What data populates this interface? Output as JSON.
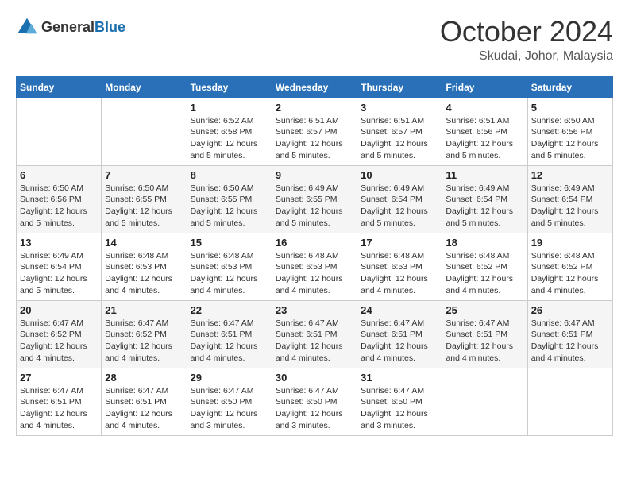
{
  "logo": {
    "general": "General",
    "blue": "Blue"
  },
  "header": {
    "month": "October 2024",
    "location": "Skudai, Johor, Malaysia"
  },
  "days_of_week": [
    "Sunday",
    "Monday",
    "Tuesday",
    "Wednesday",
    "Thursday",
    "Friday",
    "Saturday"
  ],
  "weeks": [
    [
      {
        "day": "",
        "detail": ""
      },
      {
        "day": "",
        "detail": ""
      },
      {
        "day": "1",
        "detail": "Sunrise: 6:52 AM\nSunset: 6:58 PM\nDaylight: 12 hours and 5 minutes."
      },
      {
        "day": "2",
        "detail": "Sunrise: 6:51 AM\nSunset: 6:57 PM\nDaylight: 12 hours and 5 minutes."
      },
      {
        "day": "3",
        "detail": "Sunrise: 6:51 AM\nSunset: 6:57 PM\nDaylight: 12 hours and 5 minutes."
      },
      {
        "day": "4",
        "detail": "Sunrise: 6:51 AM\nSunset: 6:56 PM\nDaylight: 12 hours and 5 minutes."
      },
      {
        "day": "5",
        "detail": "Sunrise: 6:50 AM\nSunset: 6:56 PM\nDaylight: 12 hours and 5 minutes."
      }
    ],
    [
      {
        "day": "6",
        "detail": "Sunrise: 6:50 AM\nSunset: 6:56 PM\nDaylight: 12 hours and 5 minutes."
      },
      {
        "day": "7",
        "detail": "Sunrise: 6:50 AM\nSunset: 6:55 PM\nDaylight: 12 hours and 5 minutes."
      },
      {
        "day": "8",
        "detail": "Sunrise: 6:50 AM\nSunset: 6:55 PM\nDaylight: 12 hours and 5 minutes."
      },
      {
        "day": "9",
        "detail": "Sunrise: 6:49 AM\nSunset: 6:55 PM\nDaylight: 12 hours and 5 minutes."
      },
      {
        "day": "10",
        "detail": "Sunrise: 6:49 AM\nSunset: 6:54 PM\nDaylight: 12 hours and 5 minutes."
      },
      {
        "day": "11",
        "detail": "Sunrise: 6:49 AM\nSunset: 6:54 PM\nDaylight: 12 hours and 5 minutes."
      },
      {
        "day": "12",
        "detail": "Sunrise: 6:49 AM\nSunset: 6:54 PM\nDaylight: 12 hours and 5 minutes."
      }
    ],
    [
      {
        "day": "13",
        "detail": "Sunrise: 6:49 AM\nSunset: 6:54 PM\nDaylight: 12 hours and 5 minutes."
      },
      {
        "day": "14",
        "detail": "Sunrise: 6:48 AM\nSunset: 6:53 PM\nDaylight: 12 hours and 4 minutes."
      },
      {
        "day": "15",
        "detail": "Sunrise: 6:48 AM\nSunset: 6:53 PM\nDaylight: 12 hours and 4 minutes."
      },
      {
        "day": "16",
        "detail": "Sunrise: 6:48 AM\nSunset: 6:53 PM\nDaylight: 12 hours and 4 minutes."
      },
      {
        "day": "17",
        "detail": "Sunrise: 6:48 AM\nSunset: 6:53 PM\nDaylight: 12 hours and 4 minutes."
      },
      {
        "day": "18",
        "detail": "Sunrise: 6:48 AM\nSunset: 6:52 PM\nDaylight: 12 hours and 4 minutes."
      },
      {
        "day": "19",
        "detail": "Sunrise: 6:48 AM\nSunset: 6:52 PM\nDaylight: 12 hours and 4 minutes."
      }
    ],
    [
      {
        "day": "20",
        "detail": "Sunrise: 6:47 AM\nSunset: 6:52 PM\nDaylight: 12 hours and 4 minutes."
      },
      {
        "day": "21",
        "detail": "Sunrise: 6:47 AM\nSunset: 6:52 PM\nDaylight: 12 hours and 4 minutes."
      },
      {
        "day": "22",
        "detail": "Sunrise: 6:47 AM\nSunset: 6:51 PM\nDaylight: 12 hours and 4 minutes."
      },
      {
        "day": "23",
        "detail": "Sunrise: 6:47 AM\nSunset: 6:51 PM\nDaylight: 12 hours and 4 minutes."
      },
      {
        "day": "24",
        "detail": "Sunrise: 6:47 AM\nSunset: 6:51 PM\nDaylight: 12 hours and 4 minutes."
      },
      {
        "day": "25",
        "detail": "Sunrise: 6:47 AM\nSunset: 6:51 PM\nDaylight: 12 hours and 4 minutes."
      },
      {
        "day": "26",
        "detail": "Sunrise: 6:47 AM\nSunset: 6:51 PM\nDaylight: 12 hours and 4 minutes."
      }
    ],
    [
      {
        "day": "27",
        "detail": "Sunrise: 6:47 AM\nSunset: 6:51 PM\nDaylight: 12 hours and 4 minutes."
      },
      {
        "day": "28",
        "detail": "Sunrise: 6:47 AM\nSunset: 6:51 PM\nDaylight: 12 hours and 4 minutes."
      },
      {
        "day": "29",
        "detail": "Sunrise: 6:47 AM\nSunset: 6:50 PM\nDaylight: 12 hours and 3 minutes."
      },
      {
        "day": "30",
        "detail": "Sunrise: 6:47 AM\nSunset: 6:50 PM\nDaylight: 12 hours and 3 minutes."
      },
      {
        "day": "31",
        "detail": "Sunrise: 6:47 AM\nSunset: 6:50 PM\nDaylight: 12 hours and 3 minutes."
      },
      {
        "day": "",
        "detail": ""
      },
      {
        "day": "",
        "detail": ""
      }
    ]
  ]
}
